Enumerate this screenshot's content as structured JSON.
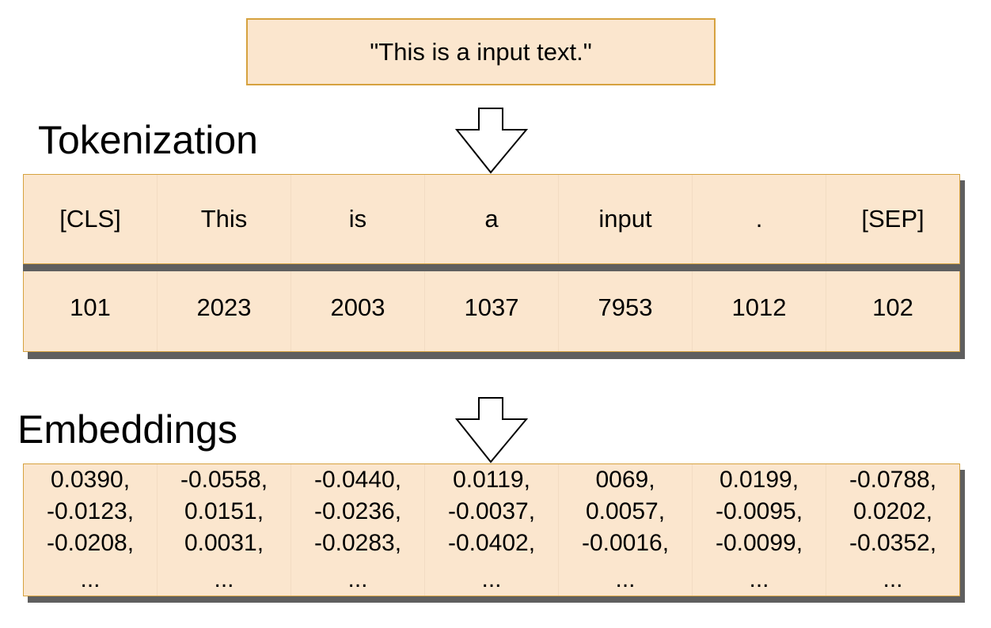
{
  "input_text": "\"This is a input text.\"",
  "sections": {
    "tokenization_title": "Tokenization",
    "embeddings_title": "Embeddings"
  },
  "tokens": [
    "[CLS]",
    "This",
    "is",
    "a",
    "input",
    ".",
    "[SEP]"
  ],
  "token_ids": [
    "101",
    "2023",
    "2003",
    "1037",
    "7953",
    "1012",
    "102"
  ],
  "embeddings": [
    {
      "v": [
        "0.0390,",
        "-0.0123,",
        "-0.0208,"
      ],
      "more": "..."
    },
    {
      "v": [
        "-0.0558,",
        "0.0151,",
        "0.0031,"
      ],
      "more": "..."
    },
    {
      "v": [
        "-0.0440,",
        "-0.0236,",
        "-0.0283,"
      ],
      "more": "..."
    },
    {
      "v": [
        "0.0119,",
        "-0.0037,",
        "-0.0402,"
      ],
      "more": "..."
    },
    {
      "v": [
        "0069,",
        "0.0057,",
        "-0.0016,"
      ],
      "more": "..."
    },
    {
      "v": [
        "0.0199,",
        "-0.0095,",
        "-0.0099,"
      ],
      "more": "..."
    },
    {
      "v": [
        "-0.0788,",
        "0.0202,",
        "-0.0352,"
      ],
      "more": "..."
    }
  ],
  "colors": {
    "fill": "#fbe6ce",
    "border": "#d6a23f",
    "shadow": "#6b6b6b"
  }
}
